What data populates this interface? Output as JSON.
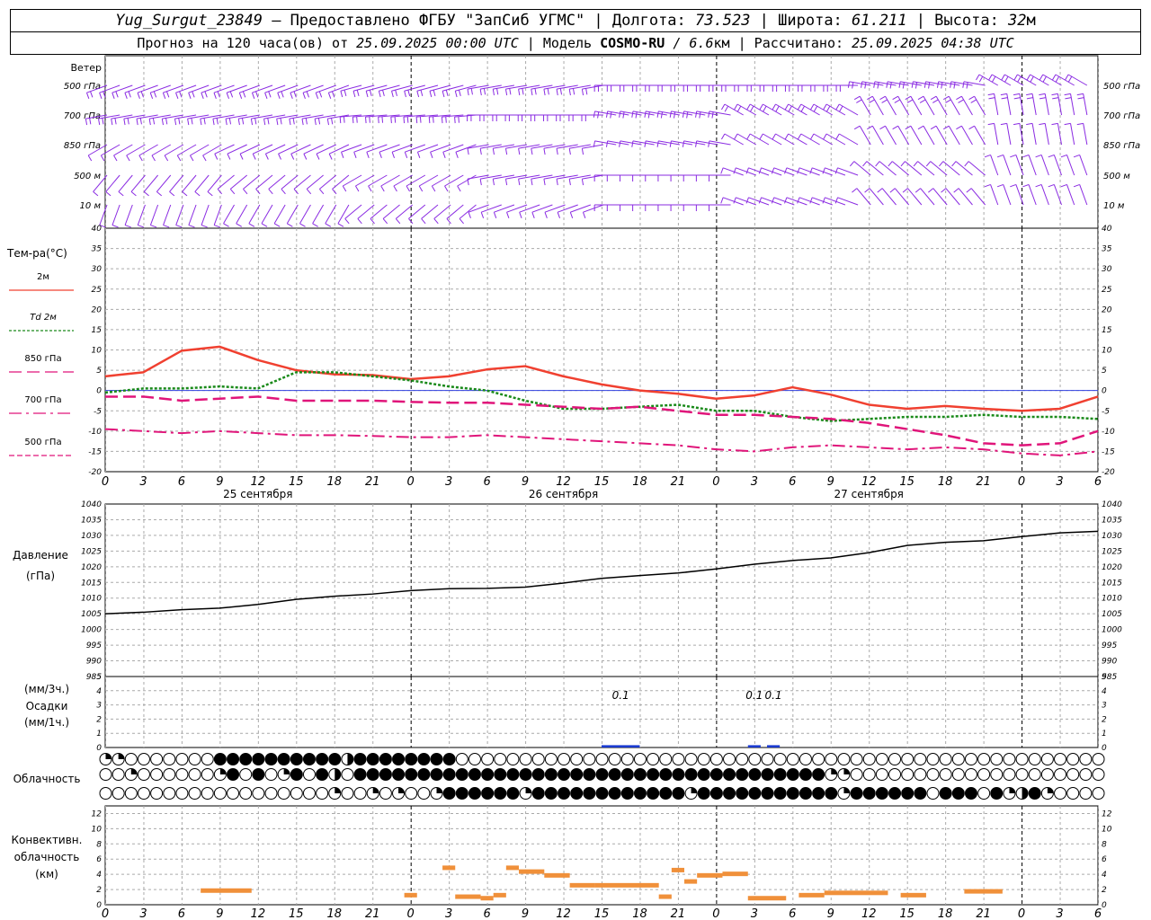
{
  "header": {
    "station": "Yug_Surgut_23849",
    "provider": " — Предоставлено ФГБУ \"ЗапСиб УГМС\" | Долгота: ",
    "lon": "73.523",
    "lat_label": " | Широта: ",
    "lat": "61.211",
    "alt_label": " | Высота: ",
    "alt": "32",
    "alt_unit": "м",
    "forecast_label": "Прогноз на 120 часа(ов) от ",
    "forecast_start": "25.09.2025 00:00 UTC",
    "model_label": " | Модель ",
    "model": "COSMO-RU",
    "resolution": " / 6.6",
    "res_unit": "км",
    "computed_label": " | Рассчитано: ",
    "computed": "25.09.2025 04:38 UTC"
  },
  "colors": {
    "wind": "#8a2be2",
    "t2m": "#f04030",
    "td2m": "#1a8a1a",
    "t850": "#e0157a",
    "t700": "#e0157a",
    "t500": "#e0157a",
    "pressure": "#000000",
    "precip": "#1a3ad0",
    "conv": "#f0903a",
    "zero_line": "#3040e0"
  },
  "chart_data": [
    {
      "type": "line",
      "name": "temperature",
      "ylabel": "Тем-ра(°C)",
      "ylim": [
        -20,
        40
      ],
      "yticks": [
        -20,
        -15,
        -10,
        -5,
        0,
        5,
        10,
        15,
        20,
        25,
        30,
        35,
        40
      ],
      "x_hours": [
        0,
        3,
        6,
        9,
        12,
        15,
        18,
        21,
        24,
        27,
        30,
        33,
        36,
        39,
        42,
        45,
        48,
        51,
        54,
        57,
        60,
        63,
        66,
        69,
        72,
        75,
        78
      ],
      "series": [
        {
          "name": "2м",
          "style": "solid",
          "values": [
            3.5,
            4.5,
            9.8,
            10.8,
            7.5,
            5.0,
            4.0,
            3.8,
            2.8,
            3.5,
            5.2,
            6.0,
            3.5,
            1.5,
            0,
            -0.8,
            -2.0,
            -1.2,
            0.8,
            -1.0,
            -3.5,
            -4.5,
            -3.8,
            -4.5,
            -5.0,
            -4.5,
            -1.5
          ]
        },
        {
          "name": "Td 2м",
          "style": "dotted",
          "values": [
            -0.5,
            0.5,
            0.5,
            1.0,
            0.5,
            4.5,
            4.5,
            3.5,
            2.5,
            1.0,
            0,
            -2.5,
            -4.5,
            -4.5,
            -4.0,
            -3.5,
            -5.0,
            -5.0,
            -6.5,
            -7.5,
            -7.0,
            -6.5,
            -6.5,
            -6.0,
            -6.5,
            -6.5,
            -7.0
          ]
        },
        {
          "name": "850 гПа",
          "style": "dashed",
          "values": [
            -1.5,
            -1.5,
            -2.5,
            -2.0,
            -1.5,
            -2.5,
            -2.5,
            -2.5,
            -2.8,
            -3.0,
            -3.0,
            -3.5,
            -4.0,
            -4.5,
            -4.0,
            -5.0,
            -6.0,
            -6.0,
            -6.5,
            -7.0,
            -8.0,
            -9.5,
            -11.0,
            -13.0,
            -13.5,
            -13.0,
            -10.0
          ]
        },
        {
          "name": "700 гПа",
          "style": "dashed",
          "values": [
            -9.5,
            -10.0,
            -10.5,
            -10.0,
            -10.5,
            -11.0,
            -11.0,
            -11.2,
            -11.5,
            -11.5,
            -11.0,
            -11.5,
            -12.0,
            -12.5,
            -13.0,
            -13.5,
            -14.5,
            -15.0,
            -14.0,
            -13.5,
            -14.0,
            -14.5,
            -14.0,
            -14.5,
            -15.5,
            -16.0,
            -15.0
          ]
        },
        {
          "name": "500 гПа",
          "style": "dashdot",
          "values": []
        }
      ]
    },
    {
      "type": "line",
      "name": "pressure",
      "ylabel": "Давление",
      "ylabel2": "(гПа)",
      "ylim": [
        985,
        1040
      ],
      "yticks": [
        985,
        990,
        995,
        1000,
        1005,
        1010,
        1015,
        1020,
        1025,
        1030,
        1035,
        1040
      ],
      "x_hours": [
        0,
        3,
        6,
        9,
        12,
        15,
        18,
        21,
        24,
        27,
        30,
        33,
        36,
        39,
        42,
        45,
        48,
        51,
        54,
        57,
        60,
        63,
        66,
        69,
        72,
        75,
        78
      ],
      "series": [
        {
          "name": "pressure",
          "values": [
            1005,
            1005.5,
            1006.3,
            1006.8,
            1008,
            1009.6,
            1010.6,
            1011.3,
            1012.4,
            1013,
            1013.1,
            1013.5,
            1014.8,
            1016.3,
            1017.2,
            1018,
            1019.3,
            1020.8,
            1022,
            1022.8,
            1024.5,
            1026.8,
            1027.8,
            1028.3,
            1029.6,
            1030.8,
            1031.3
          ]
        }
      ]
    },
    {
      "type": "bar",
      "name": "precipitation",
      "ylabel": "(мм/3ч.)",
      "ylabel2": "Осадки",
      "ylabel3": "(мм/1ч.)",
      "ylim": [
        0,
        5
      ],
      "yticks": [
        0,
        1,
        2,
        3,
        4,
        5
      ],
      "bars": [
        {
          "x_start": 39,
          "x_end": 42,
          "value": 0.1,
          "label": "0.1"
        },
        {
          "x_start": 50.5,
          "x_end": 51.5,
          "value": 0.1,
          "label": "0.1"
        },
        {
          "x_start": 52,
          "x_end": 53,
          "value": 0.1,
          "label": "0.1"
        }
      ]
    },
    {
      "type": "bar",
      "name": "convective_cloud",
      "ylabel": "Конвективн.",
      "ylabel2": "облачность",
      "ylabel3": "(км)",
      "ylim": [
        0,
        13
      ],
      "yticks": [
        0,
        2,
        4,
        6,
        8,
        10,
        12
      ],
      "segments": [
        {
          "x_start": 7.5,
          "x_end": 11.5,
          "value": 1.8
        },
        {
          "x_start": 23.5,
          "x_end": 24.5,
          "value": 1.2
        },
        {
          "x_start": 26.5,
          "x_end": 27.5,
          "value": 4.8
        },
        {
          "x_start": 27.5,
          "x_end": 29.5,
          "value": 1.0
        },
        {
          "x_start": 29.5,
          "x_end": 30.5,
          "value": 0.8
        },
        {
          "x_start": 30.5,
          "x_end": 31.5,
          "value": 1.2
        },
        {
          "x_start": 31.5,
          "x_end": 32.5,
          "value": 4.8
        },
        {
          "x_start": 32.5,
          "x_end": 34.5,
          "value": 4.3
        },
        {
          "x_start": 34.5,
          "x_end": 36.5,
          "value": 3.8
        },
        {
          "x_start": 36.5,
          "x_end": 38.5,
          "value": 2.5
        },
        {
          "x_start": 38.5,
          "x_end": 43.5,
          "value": 2.5
        },
        {
          "x_start": 43.5,
          "x_end": 44.5,
          "value": 1.0
        },
        {
          "x_start": 44.5,
          "x_end": 45.5,
          "value": 4.5
        },
        {
          "x_start": 45.5,
          "x_end": 46.5,
          "value": 3.0
        },
        {
          "x_start": 46.5,
          "x_end": 48.5,
          "value": 3.8
        },
        {
          "x_start": 48.5,
          "x_end": 50.5,
          "value": 4.0
        },
        {
          "x_start": 50.5,
          "x_end": 53.5,
          "value": 0.8
        },
        {
          "x_start": 54.5,
          "x_end": 56.5,
          "value": 1.2
        },
        {
          "x_start": 56.5,
          "x_end": 61.5,
          "value": 1.5
        },
        {
          "x_start": 62.5,
          "x_end": 64.5,
          "value": 1.2
        },
        {
          "x_start": 67.5,
          "x_end": 70.5,
          "value": 1.7
        }
      ]
    }
  ],
  "x_axis": {
    "tick_step_hours": 3,
    "max_hours": 78,
    "tick_labels": [
      "0",
      "3",
      "6",
      "9",
      "12",
      "15",
      "18",
      "21",
      "0",
      "3",
      "6",
      "9",
      "12",
      "15",
      "18",
      "21",
      "0",
      "3",
      "6",
      "9",
      "12",
      "15",
      "18",
      "21",
      "0",
      "3",
      "6"
    ],
    "day_labels": [
      {
        "hour": 12,
        "text": "25 сентября"
      },
      {
        "hour": 36,
        "text": "26 сентября"
      },
      {
        "hour": 60,
        "text": "27 сентября"
      }
    ]
  },
  "wind": {
    "title": "Ветер",
    "levels": [
      "500 гПа",
      "700 гПа",
      "850 гПа",
      "500 м",
      "10 м"
    ]
  },
  "cloud": {
    "title": "Облачность",
    "rows": [
      "33000000022222222221222222220000000000000000000000000000000000000000000000000000",
      "00300000032020320210222222222222222222222222222222222222233000000000000000000000",
      "00000000000000000030030300322222232222222222223222222222223222222022202312300000"
    ]
  }
}
